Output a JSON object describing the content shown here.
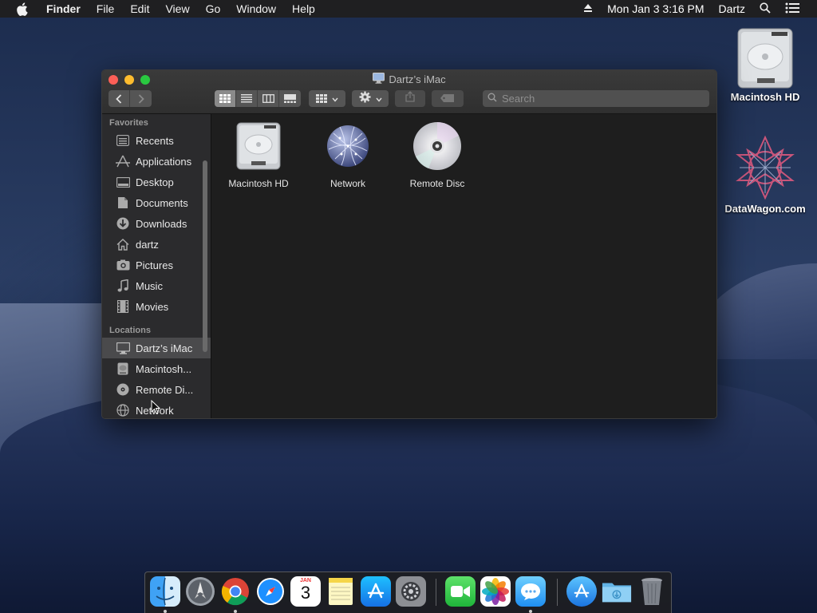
{
  "menubar": {
    "app": "Finder",
    "items": [
      "File",
      "Edit",
      "View",
      "Go",
      "Window",
      "Help"
    ],
    "clock": "Mon Jan 3  3:16 PM",
    "user": "Dartz"
  },
  "window": {
    "title": "Dartz’s iMac",
    "search_placeholder": "Search"
  },
  "sidebar": {
    "favorites_header": "Favorites",
    "favorites": [
      {
        "label": "Recents",
        "icon": "recents-icon"
      },
      {
        "label": "Applications",
        "icon": "applications-icon"
      },
      {
        "label": "Desktop",
        "icon": "desktop-icon"
      },
      {
        "label": "Documents",
        "icon": "documents-icon"
      },
      {
        "label": "Downloads",
        "icon": "downloads-icon"
      },
      {
        "label": "dartz",
        "icon": "home-icon"
      },
      {
        "label": "Pictures",
        "icon": "pictures-icon"
      },
      {
        "label": "Music",
        "icon": "music-icon"
      },
      {
        "label": "Movies",
        "icon": "movies-icon"
      }
    ],
    "locations_header": "Locations",
    "locations": [
      {
        "label": "Dartz’s iMac",
        "icon": "imac-icon",
        "selected": true
      },
      {
        "label": "Macintosh...",
        "icon": "hard-drive-icon"
      },
      {
        "label": "Remote Di...",
        "icon": "disc-icon"
      },
      {
        "label": "Network",
        "icon": "network-icon"
      }
    ]
  },
  "content": {
    "items": [
      {
        "label": "Macintosh HD",
        "icon": "hard-drive-icon"
      },
      {
        "label": "Network",
        "icon": "network-globe-icon"
      },
      {
        "label": "Remote Disc",
        "icon": "remote-disc-icon"
      }
    ]
  },
  "desktop": {
    "icons": [
      {
        "label": "Macintosh HD",
        "icon": "hard-drive-icon"
      },
      {
        "label": "DataWagon.com",
        "icon": "datawagon-icon"
      }
    ]
  },
  "dock": {
    "apps": [
      "finder",
      "launchpad",
      "chrome",
      "safari",
      "calendar",
      "notes",
      "app-store",
      "system-preferences",
      "facetime",
      "photos",
      "messages",
      "app-store-downloads",
      "downloads-folder",
      "trash"
    ],
    "calendar_month": "JAN",
    "calendar_day": "3"
  },
  "colors": {
    "close": "#fc5f57",
    "minimize": "#fdbc2e",
    "maximize": "#29c840",
    "selection": "#4a4a4c"
  }
}
